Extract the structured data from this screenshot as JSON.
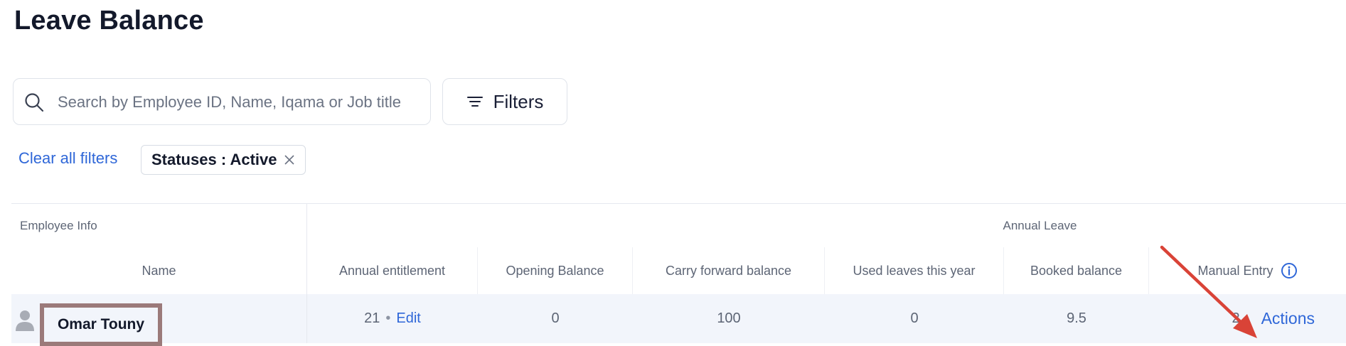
{
  "page": {
    "title": "Leave Balance"
  },
  "search": {
    "placeholder": "Search by Employee ID, Name, Iqama or Job title"
  },
  "filters": {
    "button_label": "Filters",
    "clear_all_label": "Clear all filters",
    "chips": [
      {
        "label": "Statuses : Active"
      }
    ]
  },
  "table": {
    "groups": {
      "employee_info": "Employee Info",
      "annual_leave": "Annual Leave"
    },
    "columns": {
      "name": "Name",
      "annual_entitlement": "Annual entitlement",
      "opening_balance": "Opening Balance",
      "carry_forward_balance": "Carry forward balance",
      "used_leaves": "Used leaves this year",
      "booked_balance": "Booked balance",
      "manual_entry": "Manual Entry"
    },
    "rows": [
      {
        "name": "Omar Touny",
        "annual_entitlement": "21",
        "separator": "•",
        "edit_label": "Edit",
        "opening_balance": "0",
        "carry_forward_balance": "100",
        "used_leaves": "0",
        "booked_balance": "9.5",
        "manual_entry": "2",
        "actions_label": "Actions"
      }
    ]
  },
  "colors": {
    "accent": "#2f67d8",
    "annotation_arrow": "#d94337",
    "annotation_box": "#9b7a7a"
  },
  "icons": {
    "search": "search-icon",
    "filters": "filter-lines-icon",
    "chip_close": "close-icon",
    "info": "info-icon",
    "avatar": "person-icon"
  }
}
